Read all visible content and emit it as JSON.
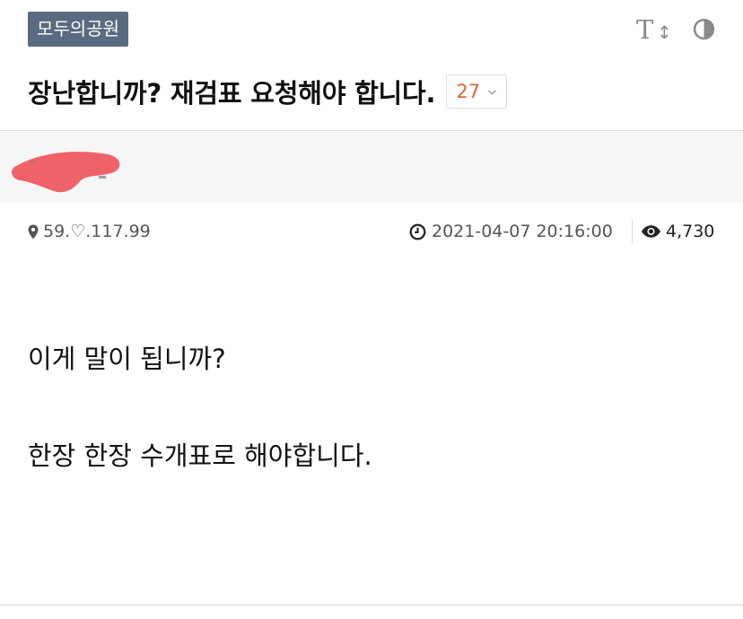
{
  "header": {
    "board_name": "모두의공원",
    "font_size_icon_label": "T",
    "font_size_icon_arrow": "↕",
    "title": "장난합니까? 재검표 요청해야 합니다.",
    "comment_count": "27"
  },
  "icons": {
    "font_size": "font-size-icon",
    "contrast": "contrast-icon",
    "location": "map-pin-icon",
    "clock": "clock-icon",
    "views": "eye-icon",
    "chevron": "chevron-down-icon"
  },
  "meta": {
    "ip": "59.♡.117.99",
    "datetime": "2021-04-07 20:16:00",
    "views": "4,730"
  },
  "post": {
    "line1": "이게 말이 됩니까?",
    "line2": "한장 한장 수개표로 해야합니다."
  },
  "colors": {
    "board_tag_bg": "#5a6a80",
    "comment_count": "#e0633f",
    "author_bar_bg": "#f6f6f6",
    "redaction": "#ee5a5f"
  }
}
